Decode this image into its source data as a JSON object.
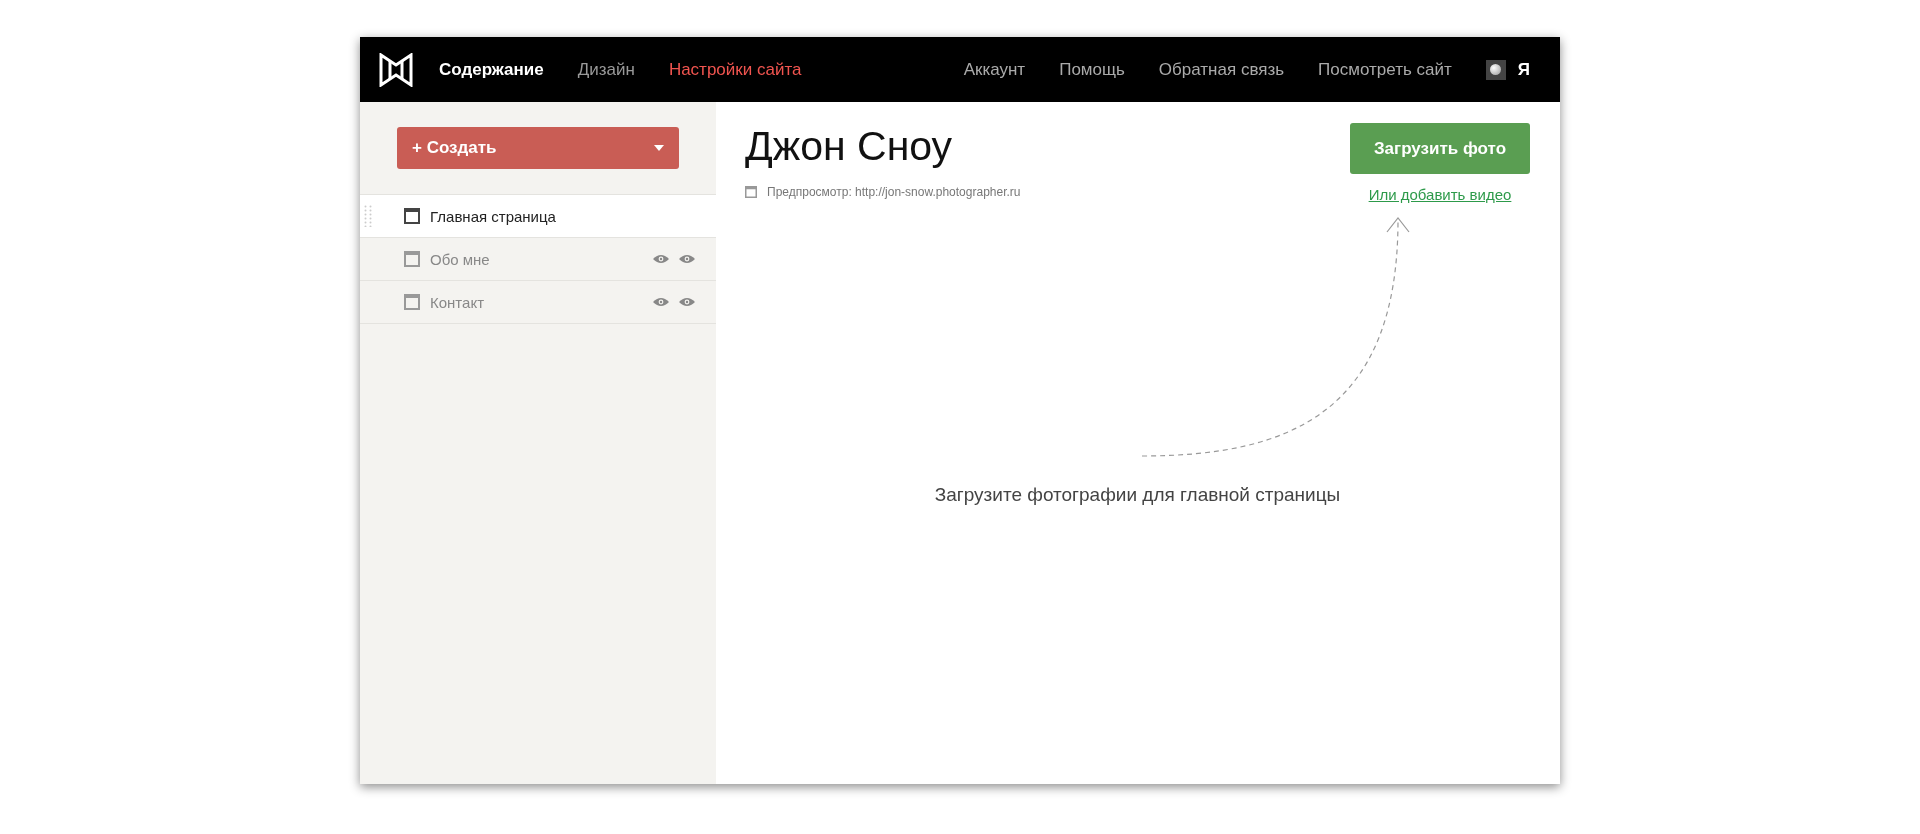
{
  "top_nav": {
    "primary": [
      {
        "label": "Содержание",
        "selected": true,
        "highlighted": false
      },
      {
        "label": "Дизайн",
        "selected": false,
        "highlighted": false
      },
      {
        "label": "Настройки сайта",
        "selected": false,
        "highlighted": true
      }
    ],
    "secondary": [
      "Аккаунт",
      "Помощь",
      "Обратная связь",
      "Посмотреть сайт"
    ],
    "user": {
      "name": "Я"
    }
  },
  "sidebar": {
    "create_button": {
      "icon_text": "+",
      "label": "Создать"
    },
    "pages": [
      {
        "title": "Главная страница",
        "selected": true
      },
      {
        "title": "Обо мне",
        "selected": false
      },
      {
        "title": "Контакт",
        "selected": false
      }
    ]
  },
  "main": {
    "title": "Джон Сноу",
    "preview": "Предпросмотр: http://jon-snow.photographer.ru",
    "upload_button": "Загрузить фото",
    "video_link": "Или добавить видео",
    "empty_message": "Загрузите фотографии для главной страницы"
  }
}
